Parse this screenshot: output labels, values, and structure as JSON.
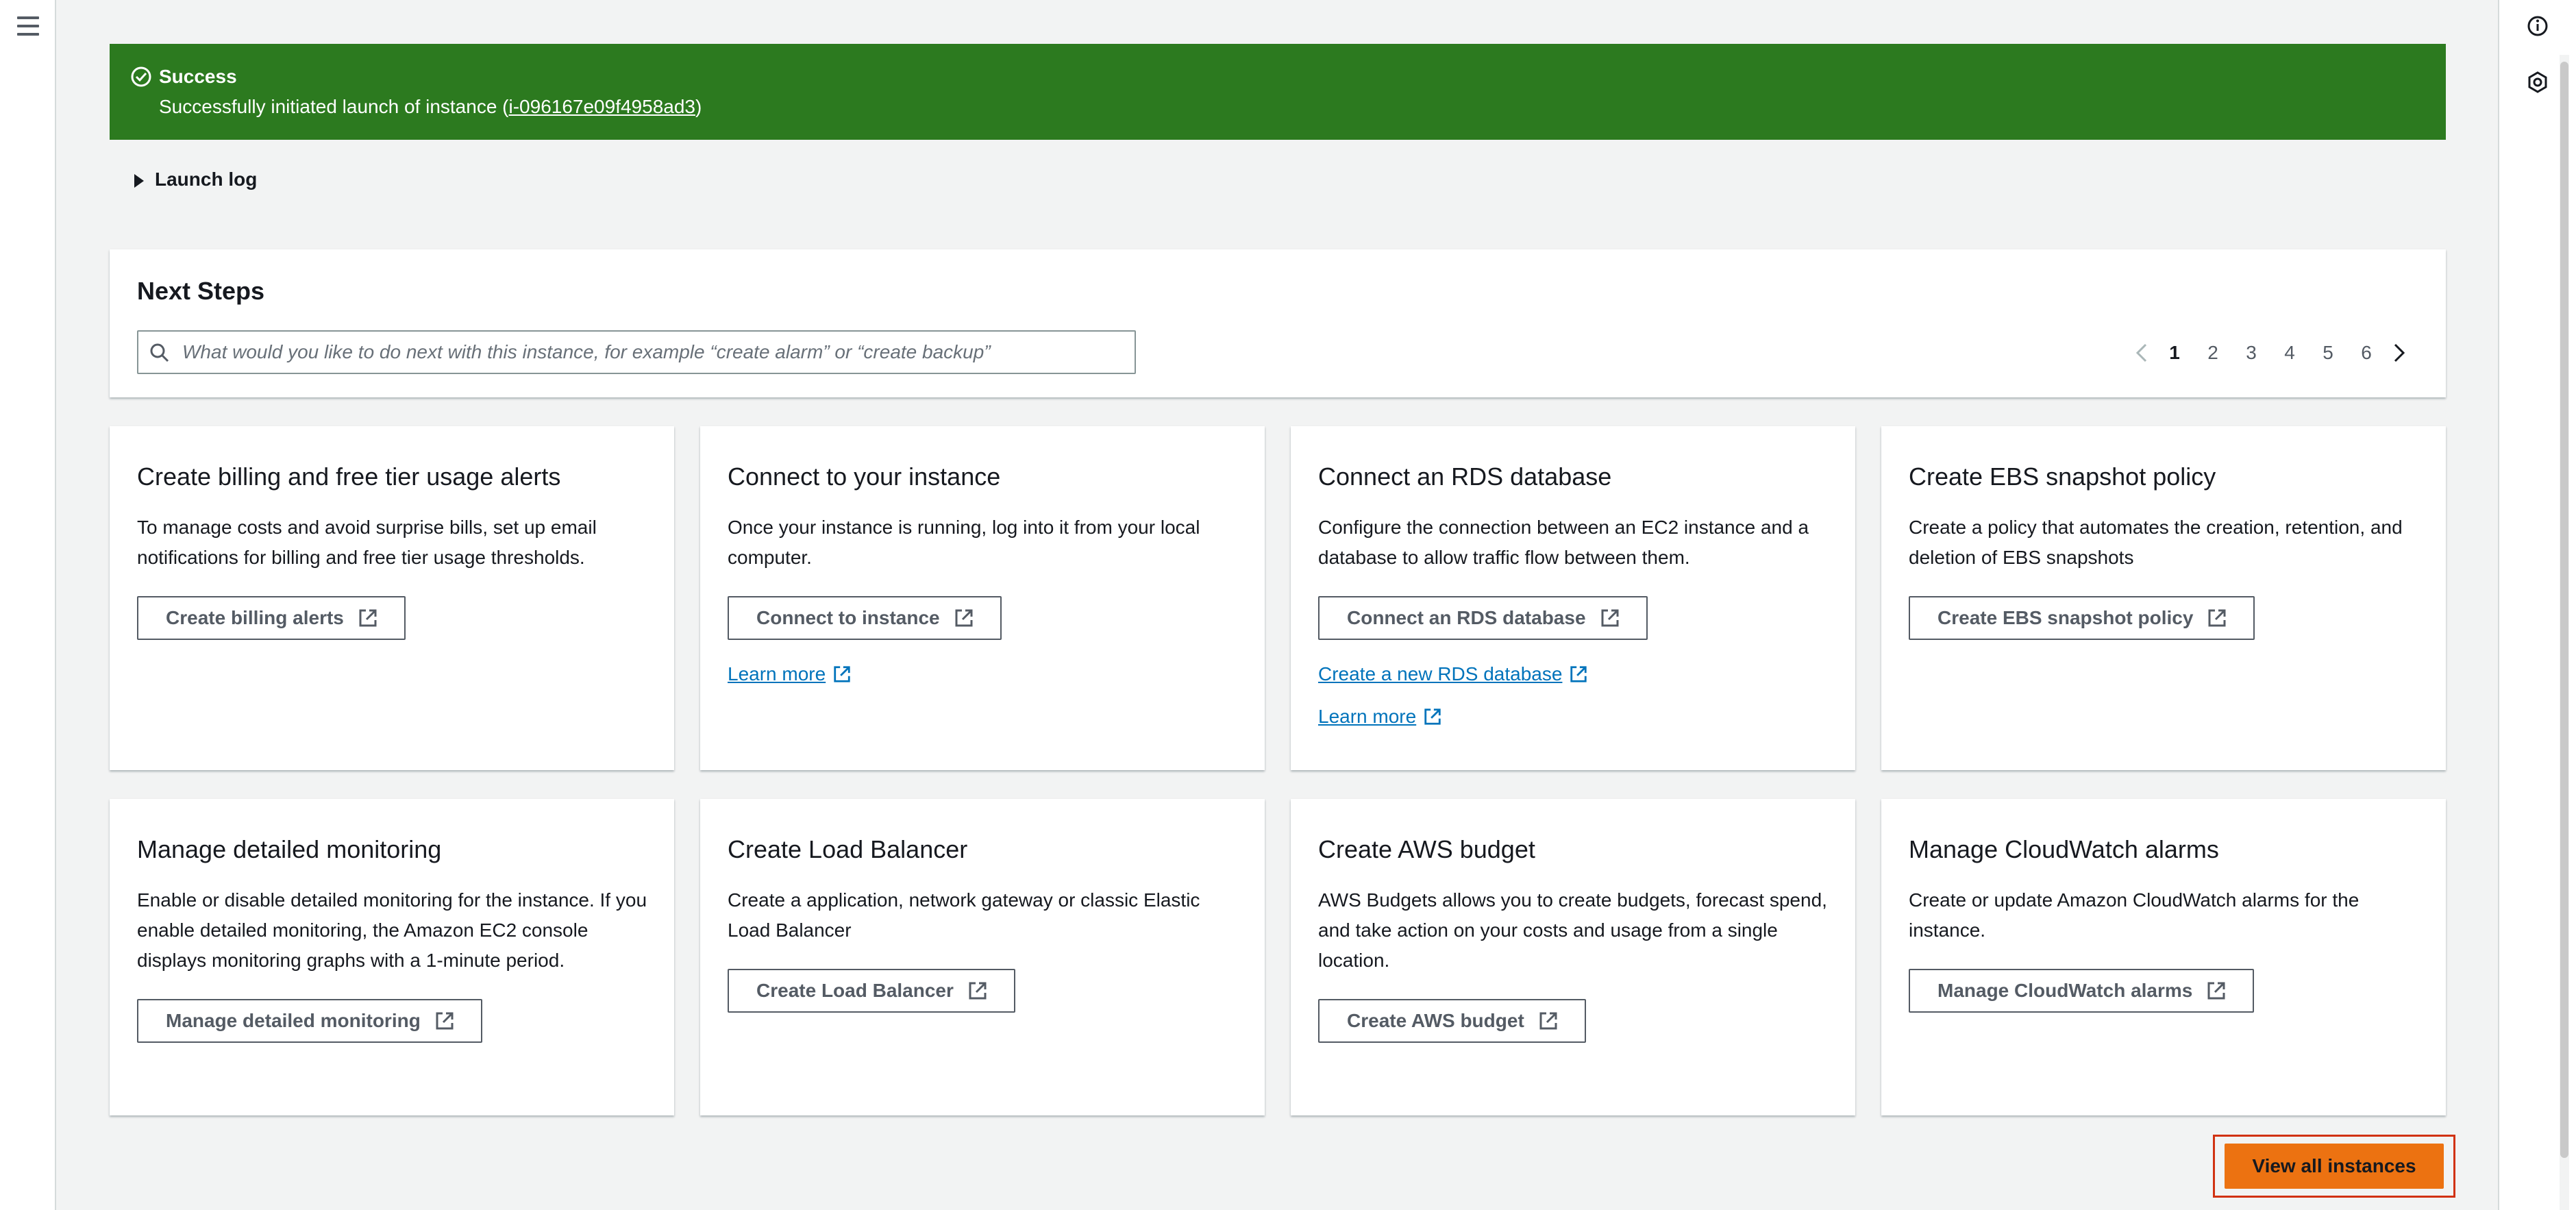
{
  "flash": {
    "title": "Success",
    "message_prefix": "Successfully initiated launch of instance (",
    "instance_id": "i-096167e09f4958ad3",
    "message_suffix": ")",
    "color": "#2c7a1f"
  },
  "launch_log": {
    "label": "Launch log"
  },
  "next_steps": {
    "title": "Next Steps",
    "search_placeholder": "What would you like to do next with this instance, for example “create alarm” or “create backup”",
    "pages": [
      "1",
      "2",
      "3",
      "4",
      "5",
      "6"
    ],
    "current_page": "1"
  },
  "cards": [
    {
      "title": "Create billing and free tier usage alerts",
      "description": "To manage costs and avoid surprise bills, set up email notifications for billing and free tier usage thresholds.",
      "button": "Create billing alerts"
    },
    {
      "title": "Connect to your instance",
      "description": "Once your instance is running, log into it from your local computer.",
      "button": "Connect to instance",
      "link1": "Learn more"
    },
    {
      "title": "Connect an RDS database",
      "description": "Configure the connection between an EC2 instance and a database to allow traffic flow between them.",
      "button": "Connect an RDS database",
      "link1": "Create a new RDS database",
      "link2": "Learn more"
    },
    {
      "title": "Create EBS snapshot policy",
      "description": "Create a policy that automates the creation, retention, and deletion of EBS snapshots",
      "button": "Create EBS snapshot policy"
    },
    {
      "title": "Manage detailed monitoring",
      "description": "Enable or disable detailed monitoring for the instance. If you enable detailed monitoring, the Amazon EC2 console displays monitoring graphs with a 1-minute period.",
      "button": "Manage detailed monitoring"
    },
    {
      "title": "Create Load Balancer",
      "description": "Create a application, network gateway or classic Elastic Load Balancer",
      "button": "Create Load Balancer"
    },
    {
      "title": "Create AWS budget",
      "description": "AWS Budgets allows you to create budgets, forecast spend, and take action on your costs and usage from a single location.",
      "button": "Create AWS budget"
    },
    {
      "title": "Manage CloudWatch alarms",
      "description": "Create or update Amazon CloudWatch alarms for the instance.",
      "button": "Manage CloudWatch alarms"
    }
  ],
  "footer": {
    "primary_button": "View all instances",
    "primary_color": "#ec7211"
  },
  "icons": {
    "menu": "hamburger-menu-icon",
    "info": "info-icon",
    "settings": "gear-icon",
    "success": "check-circle-icon",
    "external": "external-link-icon",
    "search": "search-icon"
  }
}
